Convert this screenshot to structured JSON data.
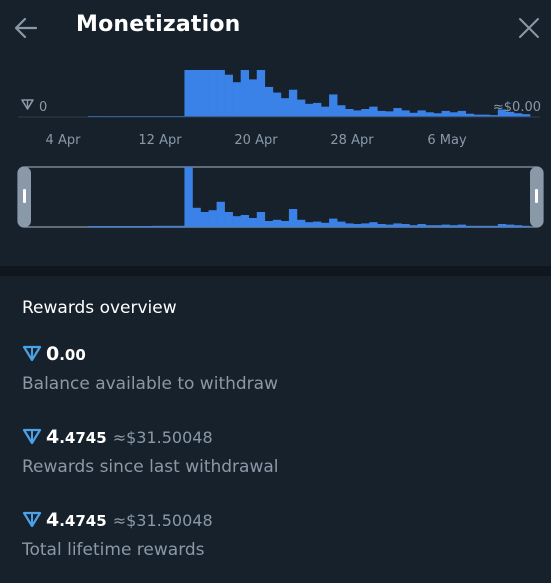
{
  "header": {
    "title": "Monetization"
  },
  "chart": {
    "left_label": "0",
    "right_label": "≈$0.00",
    "x_ticks": [
      "4 Apr",
      "12 Apr",
      "20 Apr",
      "28 Apr",
      "6 May"
    ]
  },
  "chart_data": {
    "type": "bar",
    "ylabel": "",
    "xlabel": "",
    "ylim_note": "relative",
    "bar_color": "#3a82e8",
    "values": [
      0,
      0,
      0,
      0,
      0,
      0,
      1,
      1,
      2,
      2,
      2,
      2,
      100,
      100,
      100,
      100,
      100,
      90,
      74,
      100,
      80,
      100,
      64,
      52,
      40,
      58,
      37,
      28,
      30,
      22,
      48,
      25,
      17,
      14,
      17,
      22,
      13,
      12,
      19,
      14,
      9,
      14,
      10,
      8,
      13,
      10,
      13,
      7,
      5,
      5,
      4,
      16,
      11,
      8,
      6
    ],
    "overview_values": [
      0,
      0,
      0,
      0,
      0,
      0,
      1,
      1,
      2,
      2,
      2,
      2,
      100,
      32,
      25,
      28,
      42,
      25,
      18,
      20,
      15,
      25,
      10,
      12,
      10,
      30,
      12,
      8,
      9,
      7,
      14,
      9,
      6,
      5,
      6,
      8,
      5,
      4,
      6,
      5,
      3,
      5,
      3,
      3,
      4,
      3,
      4,
      2,
      2,
      2,
      2,
      5,
      4,
      3,
      2
    ]
  },
  "overview": {
    "title": "Rewards overview",
    "stats": [
      {
        "int": "0",
        "frac": ".00",
        "usd": "",
        "desc": "Balance available to withdraw"
      },
      {
        "int": "4",
        "frac": ".4745",
        "usd": "≈$31.50048",
        "desc": "Rewards since last withdrawal"
      },
      {
        "int": "4",
        "frac": ".4745",
        "usd": "≈$31.50048",
        "desc": "Total lifetime rewards"
      }
    ]
  },
  "colors": {
    "background": "#17212b",
    "accent": "#3a82e8",
    "ton": "#4aa3e8",
    "muted": "#8a99a8"
  },
  "icons": {
    "back": "arrow-left-icon",
    "close": "close-icon",
    "currency": "ton-icon"
  }
}
